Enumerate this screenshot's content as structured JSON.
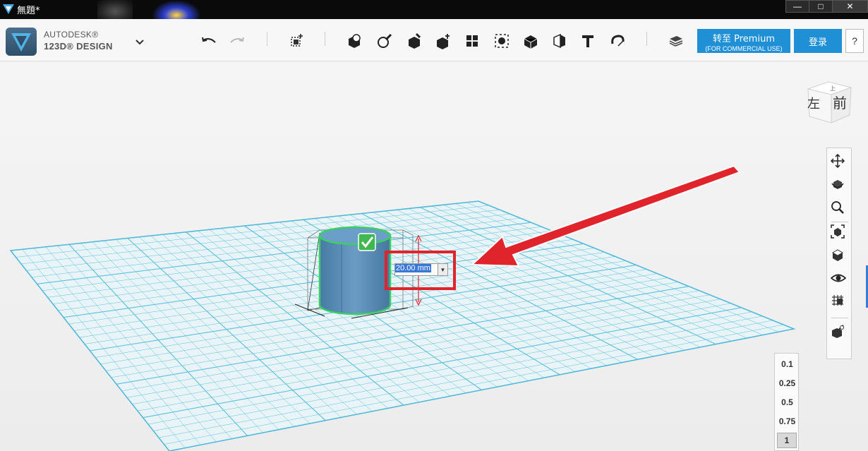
{
  "window": {
    "title": "無題*",
    "minimize_glyph": "—",
    "maximize_glyph": "□",
    "close_glyph": "✕"
  },
  "brand": {
    "line1": "AUTODESK®",
    "line2": "123D® DESIGN"
  },
  "toolbar": {
    "icons": [
      "undo-icon",
      "redo-icon",
      "transform-icon",
      "primitives-icon",
      "sketch-icon",
      "construct-icon",
      "modify-icon",
      "pattern-icon",
      "grouping-icon",
      "combine-icon",
      "measure-icon",
      "text-icon",
      "snap-icon",
      "material-icon"
    ],
    "premium_label": "转至 Premium",
    "premium_sub": "(FOR COMMERCIAL USE)",
    "login_label": "登录",
    "help_label": "?"
  },
  "viewcube": {
    "left_face": "左",
    "front_face": "前",
    "top_face": "上"
  },
  "dimension": {
    "value": "20.00 mm",
    "dropdown_glyph": "▼"
  },
  "navbar": {
    "icons": [
      "pan-icon",
      "orbit-icon",
      "zoom-icon",
      "fit-icon",
      "view-mode-icon",
      "visibility-icon",
      "grid-toggle-icon",
      "material-view-icon"
    ]
  },
  "snap": {
    "options": [
      "0.1",
      "0.25",
      "0.5",
      "0.75",
      "1"
    ],
    "selected": "1"
  },
  "colors": {
    "accent": "#1f8fd6",
    "grid": "#5ac0de",
    "object": "#5b8fb9",
    "selection": "#3acf62",
    "annotation": "#e0242c"
  }
}
